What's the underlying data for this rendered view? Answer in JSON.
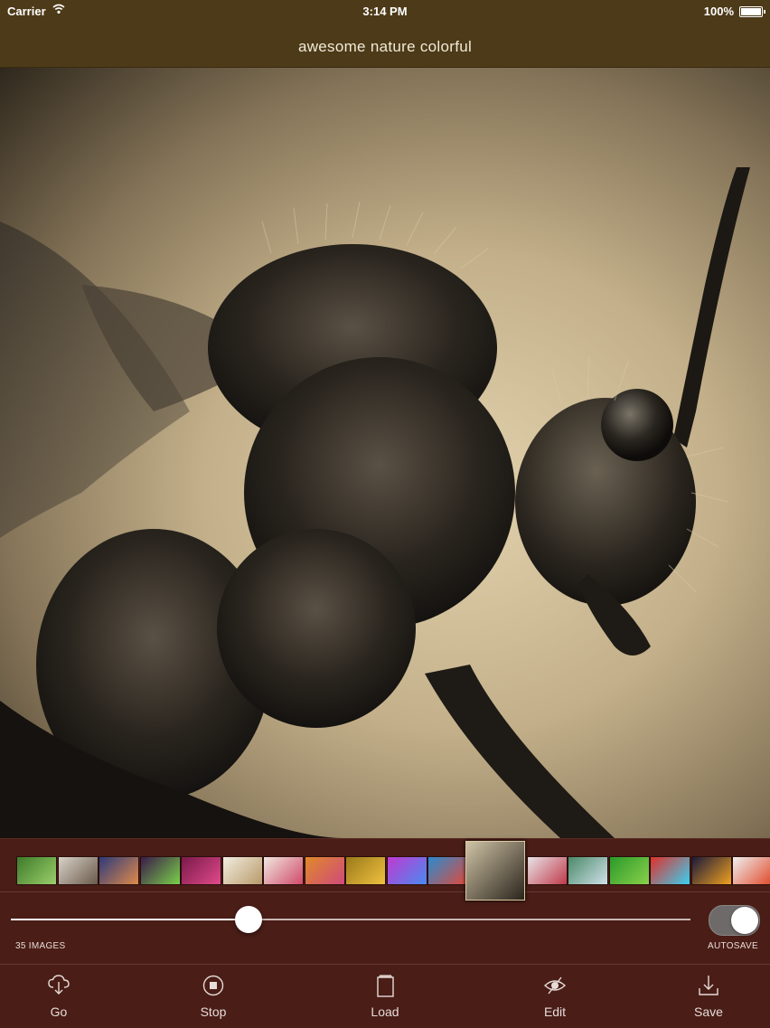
{
  "status_bar": {
    "carrier": "Carrier",
    "time": "3:14 PM",
    "battery": "100%",
    "battery_level": 1.0
  },
  "nav": {
    "title": "awesome nature colorful"
  },
  "photo": {
    "subject_icon": "fly-macro-photo",
    "tone": "sepia"
  },
  "thumbnails": {
    "selected_index": 11,
    "items": [
      {
        "name": "thumb-1",
        "colors": [
          "#3d7a2a",
          "#9bcf6a"
        ]
      },
      {
        "name": "thumb-2",
        "colors": [
          "#d8d2c8",
          "#6a5a4a"
        ]
      },
      {
        "name": "thumb-3",
        "colors": [
          "#2d3a7a",
          "#e08a4a"
        ]
      },
      {
        "name": "thumb-4",
        "colors": [
          "#3a1a4a",
          "#7ad04a"
        ]
      },
      {
        "name": "thumb-5",
        "colors": [
          "#7a1a4a",
          "#e04a8a"
        ]
      },
      {
        "name": "thumb-6",
        "colors": [
          "#f2ede0",
          "#b89a6a"
        ]
      },
      {
        "name": "thumb-7",
        "colors": [
          "#f0e8e0",
          "#d04a6a"
        ]
      },
      {
        "name": "thumb-8",
        "colors": [
          "#e08a2a",
          "#d04a7a"
        ]
      },
      {
        "name": "thumb-9",
        "colors": [
          "#9a7a1a",
          "#f0c040"
        ]
      },
      {
        "name": "thumb-10",
        "colors": [
          "#c03ad0",
          "#4a8af0"
        ]
      },
      {
        "name": "thumb-11",
        "colors": [
          "#2a8ad0",
          "#e04a3a"
        ]
      },
      {
        "name": "thumb-12",
        "colors": [
          "#cfc3a6",
          "#2a241c"
        ]
      },
      {
        "name": "thumb-13",
        "colors": [
          "#e8e4e8",
          "#c03a4a"
        ]
      },
      {
        "name": "thumb-14",
        "colors": [
          "#4a8a6a",
          "#d0e0e8"
        ]
      },
      {
        "name": "thumb-15",
        "colors": [
          "#2a9a2a",
          "#8ad04a"
        ]
      },
      {
        "name": "thumb-16",
        "colors": [
          "#e0302a",
          "#3ad0f0"
        ]
      },
      {
        "name": "thumb-17",
        "colors": [
          "#1a1a3a",
          "#f0a020"
        ]
      },
      {
        "name": "thumb-18",
        "colors": [
          "#f0f0f0",
          "#e04a2a"
        ]
      }
    ]
  },
  "slider": {
    "value_fraction": 0.35
  },
  "images_count_label": "35 IMAGES",
  "autosave": {
    "label": "AUTOSAVE",
    "on": true
  },
  "tabs": [
    {
      "label": "Go",
      "icon": "cloud-download-icon"
    },
    {
      "label": "Stop",
      "icon": "stop-circle-icon"
    },
    {
      "label": "Load",
      "icon": "document-stack-icon"
    },
    {
      "label": "Edit",
      "icon": "eye-slash-icon"
    },
    {
      "label": "Save",
      "icon": "download-tray-icon"
    }
  ],
  "colors": {
    "nav_background": "#4d3a18",
    "panel_background": "#4a1d17",
    "accent": "#ffffff"
  }
}
